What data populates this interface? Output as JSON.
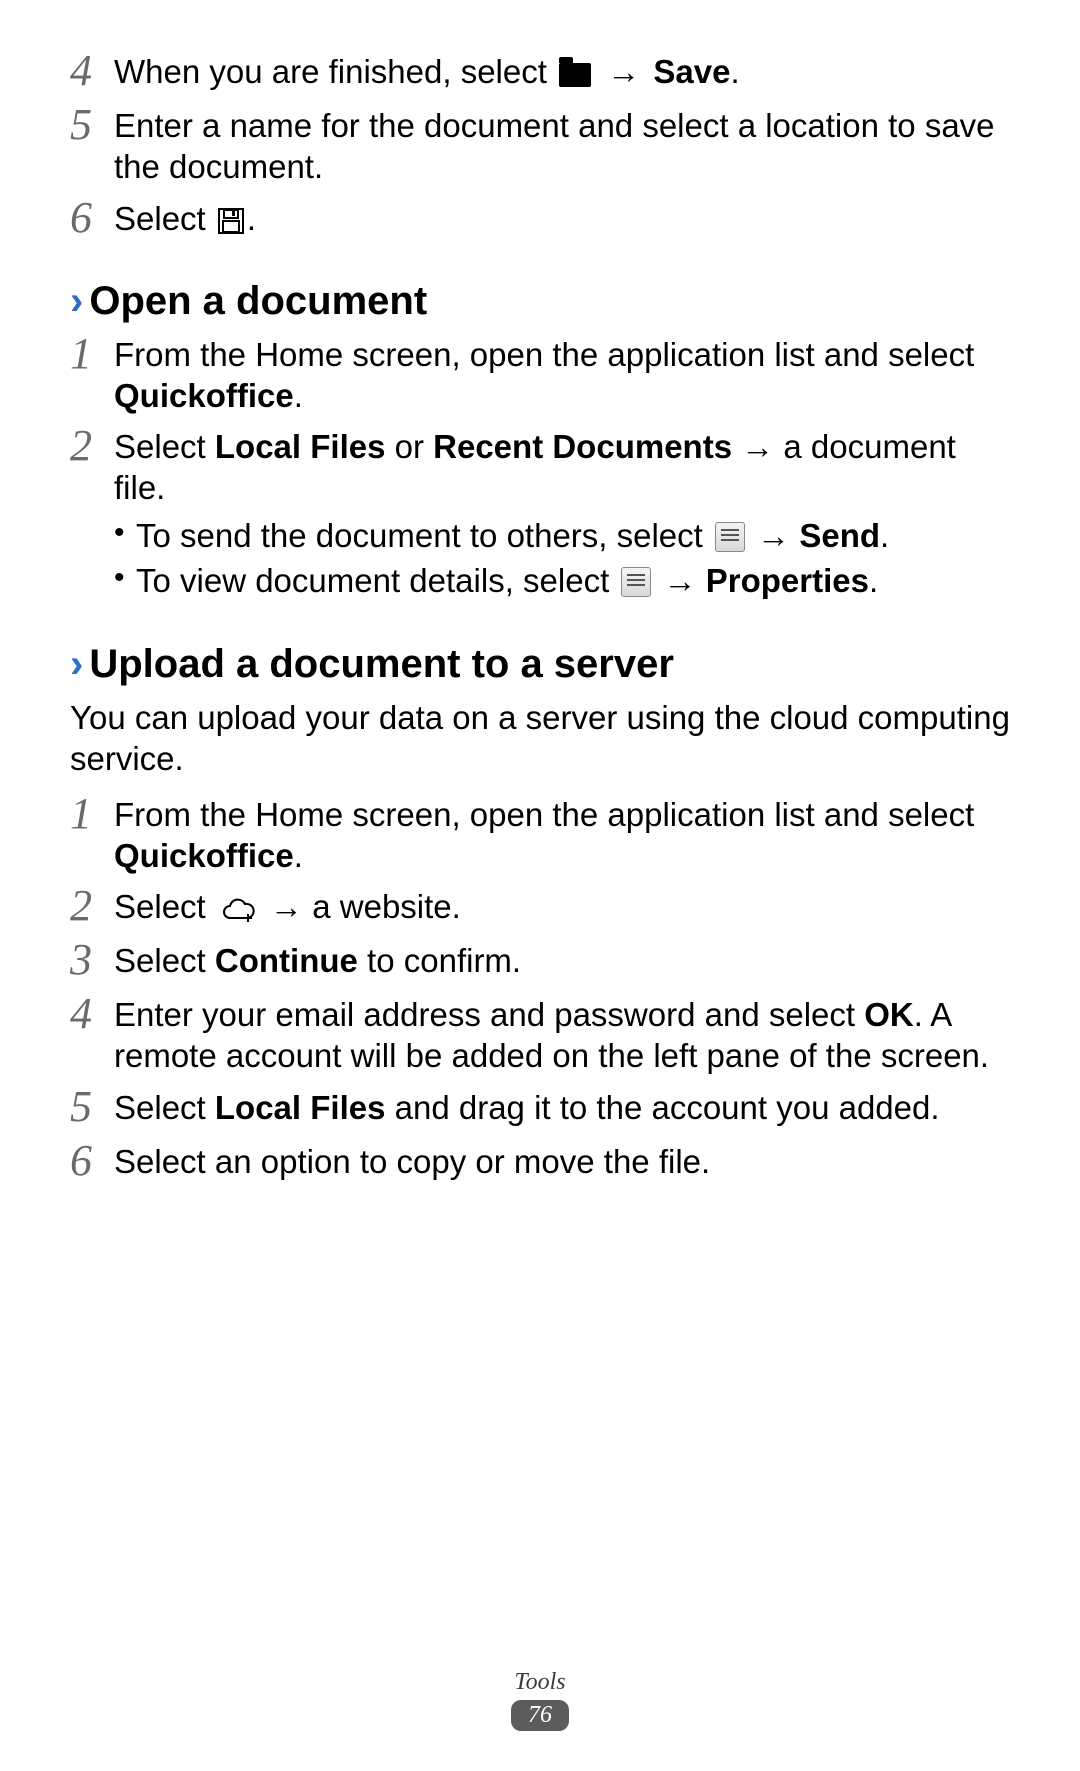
{
  "steps_a": {
    "s4": {
      "num": "4",
      "pre": "When you are finished, select ",
      "arrow": "→",
      "post": "Save",
      "tail": "."
    },
    "s5": {
      "num": "5",
      "text": "Enter a name for the document and select a location to save the document."
    },
    "s6": {
      "num": "6",
      "pre": "Select ",
      "tail": "."
    }
  },
  "heading_open": {
    "chev": "›",
    "text": "Open a document"
  },
  "steps_b": {
    "s1": {
      "num": "1",
      "pre": "From the Home screen, open the application list and select ",
      "bold": "Quickoffice",
      "tail": "."
    },
    "s2": {
      "num": "2",
      "pre": "Select ",
      "b1": "Local Files",
      "mid1": " or ",
      "b2": "Recent Documents",
      "arrow": " → ",
      "post": "a document file.",
      "bullets": {
        "b1": {
          "pre": "To send the document to others, select ",
          "arrow": " → ",
          "bold": "Send",
          "tail": "."
        },
        "b2": {
          "pre": "To view document details, select ",
          "arrow": " → ",
          "bold": "Properties",
          "tail": "."
        }
      }
    }
  },
  "heading_upload": {
    "chev": "›",
    "text": "Upload a document to a server"
  },
  "upload_intro": "You can upload your data on a server using the cloud computing service.",
  "steps_c": {
    "s1": {
      "num": "1",
      "pre": "From the Home screen, open the application list and select ",
      "bold": "Quickoffice",
      "tail": "."
    },
    "s2": {
      "num": "2",
      "pre": "Select ",
      "arrow": " → ",
      "post": "a website."
    },
    "s3": {
      "num": "3",
      "pre": "Select ",
      "bold": "Continue",
      "post": " to confirm."
    },
    "s4": {
      "num": "4",
      "pre": "Enter your email address and password and select ",
      "bold": "OK",
      "post": ". A remote account will be added on the left pane of the screen."
    },
    "s5": {
      "num": "5",
      "pre": "Select ",
      "bold": "Local Files",
      "post": " and drag it to the account you added."
    },
    "s6": {
      "num": "6",
      "text": "Select an option to copy or move the file."
    }
  },
  "footer": {
    "section": "Tools",
    "page": "76"
  },
  "dot": "•"
}
